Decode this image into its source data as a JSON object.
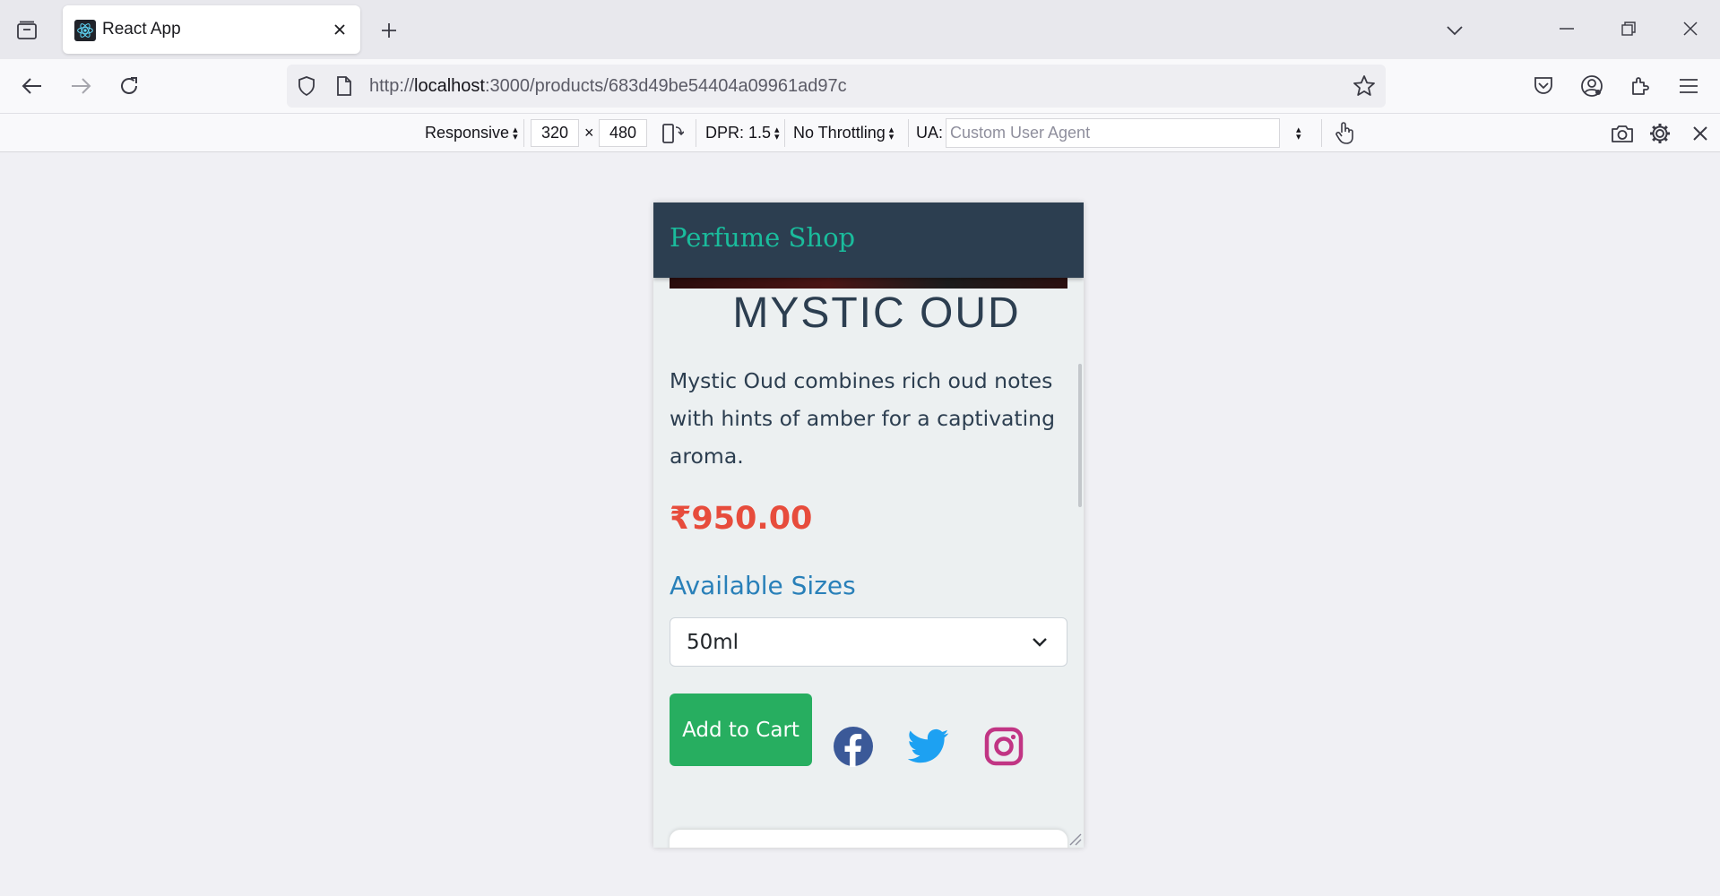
{
  "browser": {
    "tab_title": "React App",
    "url_prefix": "http://",
    "url_host": "localhost",
    "url_rest": ":3000/products/683d49be54404a09961ad97c"
  },
  "rdm": {
    "device": "Responsive",
    "width": "320",
    "times": "×",
    "height": "480",
    "dpr": "DPR: 1.5",
    "throttling": "No Throttling",
    "ua_label": "UA:",
    "ua_placeholder": "Custom User Agent"
  },
  "site": {
    "brand": "Perfume Shop",
    "product": {
      "name": "MYSTIC OUD",
      "description": "Mystic Oud combines rich oud notes with hints of amber for a captivating aroma.",
      "price": "₹950.00",
      "sizes_heading": "Available Sizes",
      "selected_size": "50ml",
      "add_to_cart": "Add to Cart"
    },
    "social": [
      "facebook-icon",
      "twitter-icon",
      "instagram-icon"
    ]
  },
  "colors": {
    "header_bg": "#2c3e50",
    "brand": "#1abc9c",
    "price": "#e74c3c",
    "heading_blue": "#2980b9",
    "cart_green": "#27ae60",
    "facebook": "#3b5998",
    "twitter": "#1da1f2",
    "instagram": "#c13584"
  }
}
